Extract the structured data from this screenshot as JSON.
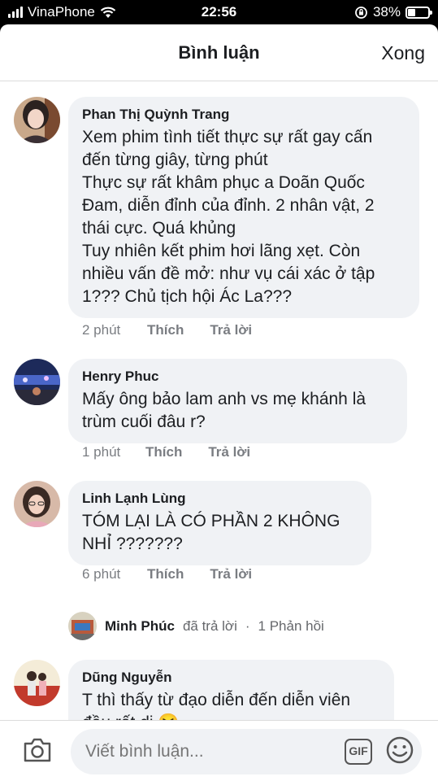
{
  "status_bar": {
    "carrier": "VinaPhone",
    "time": "22:56",
    "battery_percent": "38%",
    "battery_level": 0.38
  },
  "header": {
    "title": "Bình luận",
    "done_label": "Xong"
  },
  "comments": [
    {
      "author": "Phan Thị Quỳnh Trang",
      "text": "Xem phim tình tiết thực sự rất gay cấn\nđến từng giây, từng phút\nThực sự rất khâm phục a Doãn Quốc\nĐam, diễn đỉnh của đỉnh. 2 nhân vật, 2\nthái cực. Quá khủng\nTuy nhiên kết phim hơi lãng xẹt. Còn\nnhiều vấn đề mở: như vụ cái xác ở tập\n1??? Chủ tịch hội Ác La???",
      "time": "2 phút",
      "like_label": "Thích",
      "reply_label": "Trả lời"
    },
    {
      "author": "Henry Phuc",
      "text": "Mấy ông bảo lam anh vs mẹ khánh là\ntrùm cuối đâu r?",
      "time": "1 phút",
      "like_label": "Thích",
      "reply_label": "Trả lời"
    },
    {
      "author": "Linh Lạnh Lùng",
      "text": "TÓM LẠI LÀ CÓ PHẦN 2 KHÔNG\nNHỈ ???????",
      "time": "6 phút",
      "like_label": "Thích",
      "reply_label": "Trả lời"
    },
    {
      "author": "Dũng Nguyễn",
      "text": "T thì thấy từ đạo diễn đến diễn viên\nđều rất dị",
      "emoji": "😆",
      "time": "",
      "like_label": "",
      "reply_label": ""
    }
  ],
  "reply_summary": {
    "name": "Minh Phúc",
    "action": "đã trả lời",
    "separator": "·",
    "count_label": "1 Phản hồi"
  },
  "composer": {
    "placeholder": "Viết bình luận...",
    "gif_label": "GIF"
  },
  "colors": {
    "bubble": "#f0f2f5",
    "meta_text": "#7a7d82",
    "primary_text": "#1c1e21"
  }
}
